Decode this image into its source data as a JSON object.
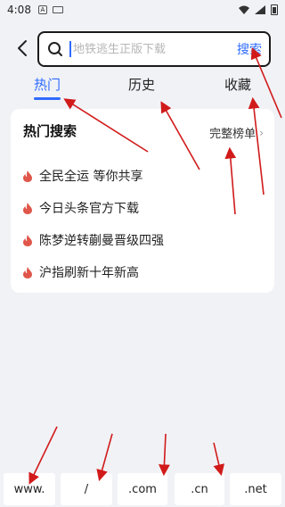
{
  "status_bar": {
    "time": "4:08",
    "icons": [
      "a-badge-icon",
      "keyboard-icon",
      "wifi-icon",
      "signal-icon",
      "battery-icon"
    ]
  },
  "search": {
    "back_icon": "chevron-left-icon",
    "placeholder": "地铁逃生正版下载",
    "button_label": "搜索",
    "accent": "#2f6bff"
  },
  "tabs": [
    {
      "label": "热门",
      "active": true
    },
    {
      "label": "历史",
      "active": false
    },
    {
      "label": "收藏",
      "active": false
    }
  ],
  "hot": {
    "title": "热门搜索",
    "more_label": "完整榜单",
    "items": [
      {
        "text": "全民全运 等你共享"
      },
      {
        "text": "今日头条官方下载"
      },
      {
        "text": "陈梦逆转蒯曼晋级四强"
      },
      {
        "text": "沪指刷新十年新高"
      }
    ],
    "flame_color": "#e0564a"
  },
  "keys": [
    "www.",
    "/",
    ".com",
    ".cn",
    ".net"
  ],
  "annotation_color": "#d11a1a"
}
